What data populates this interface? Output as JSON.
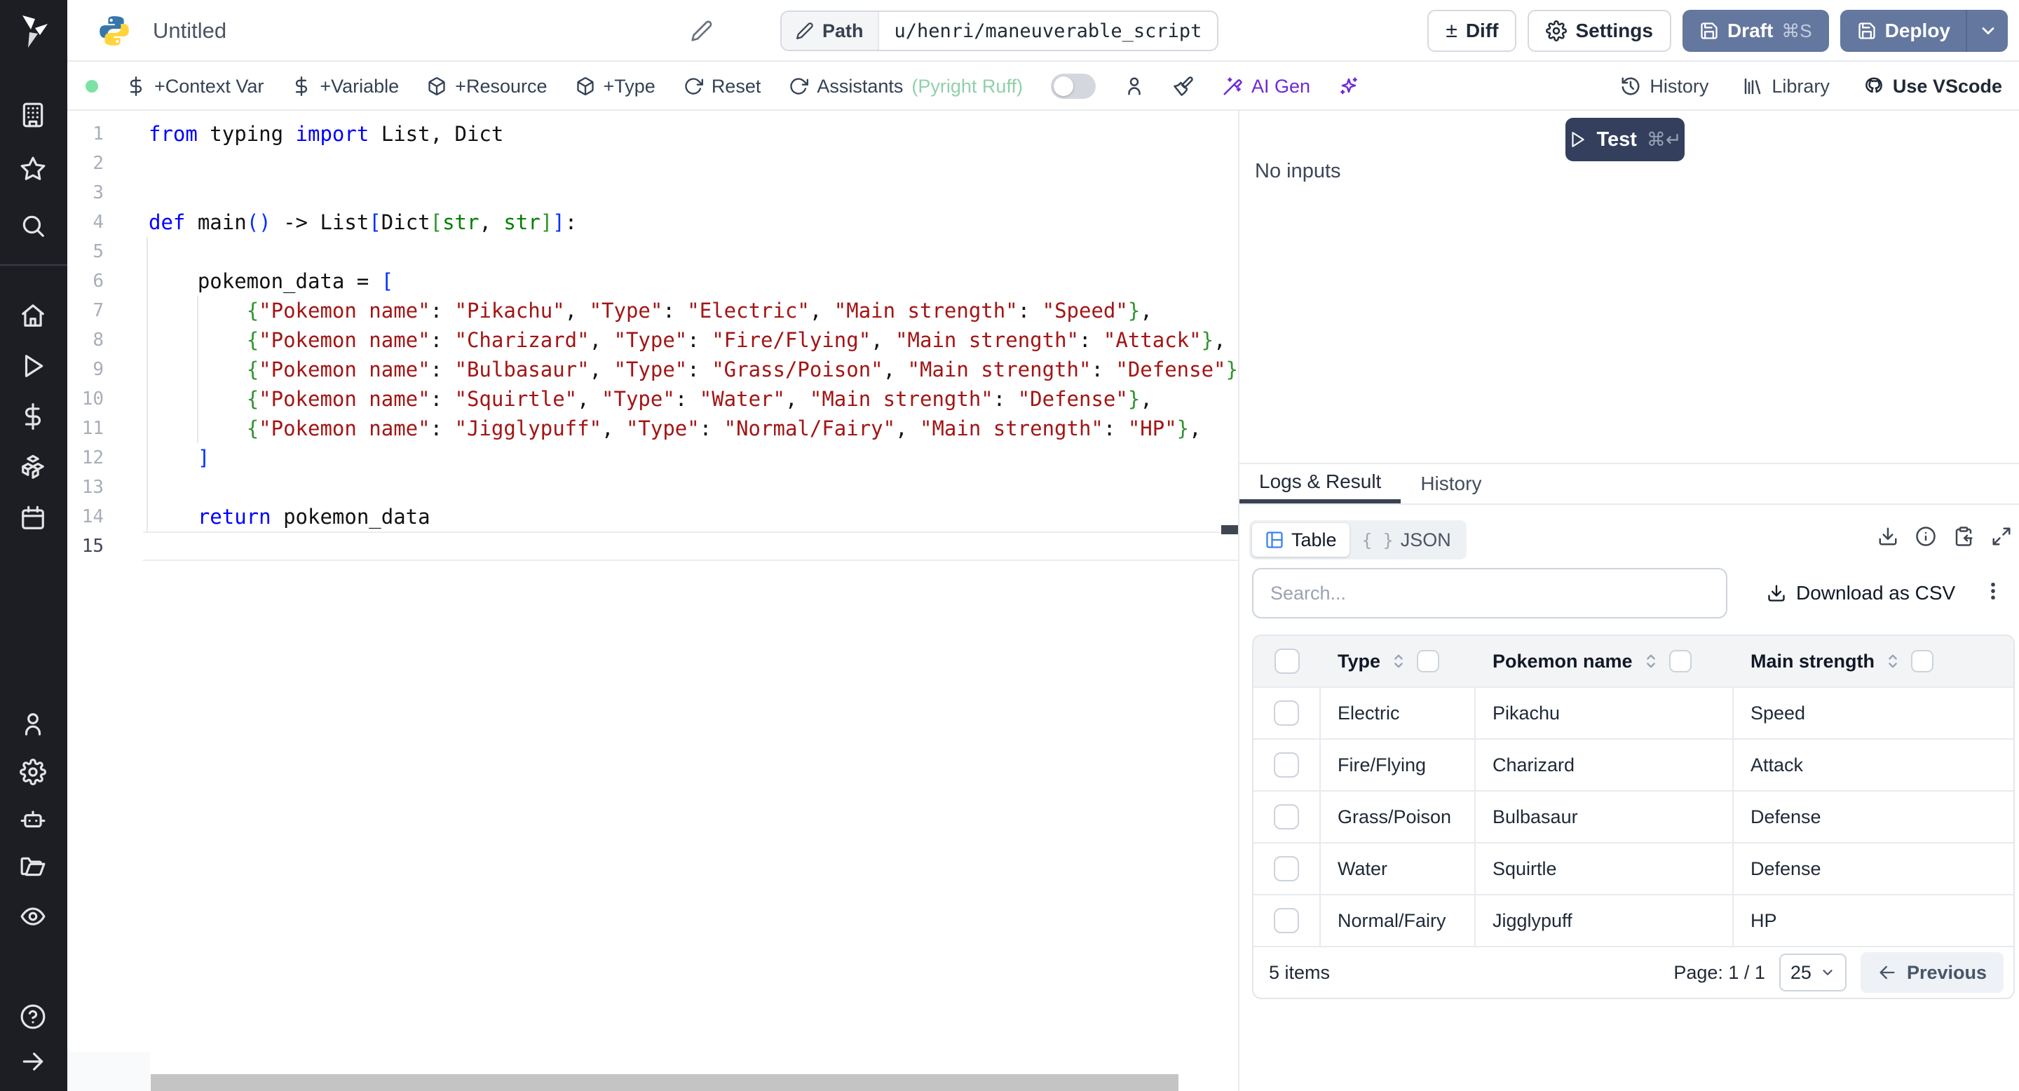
{
  "header": {
    "title": "Untitled",
    "path_label": "Path",
    "path_value": "u/henri/maneuverable_script",
    "diff_label": "Diff",
    "settings_label": "Settings",
    "draft_label": "Draft",
    "draft_shortcut": "⌘S",
    "deploy_label": "Deploy"
  },
  "toolbar": {
    "context_var": "+Context Var",
    "variable": "+Variable",
    "resource": "+Resource",
    "type": "+Type",
    "reset": "Reset",
    "assistants": "Assistants",
    "assistants_status": "(Pyright Ruff)",
    "ai_gen": "AI Gen",
    "history": "History",
    "library": "Library",
    "use_vscode": "Use VScode"
  },
  "run_panel": {
    "test_label": "Test",
    "test_shortcut": "⌘↵",
    "no_inputs": "No inputs"
  },
  "result_panel": {
    "tabs": [
      "Logs & Result",
      "History"
    ],
    "view_table": "Table",
    "view_json": "JSON",
    "braces": "{ }",
    "search_placeholder": "Search...",
    "download_csv": "Download as CSV",
    "table": {
      "columns": [
        "Type",
        "Pokemon name",
        "Main strength"
      ],
      "rows": [
        [
          "Electric",
          "Pikachu",
          "Speed"
        ],
        [
          "Fire/Flying",
          "Charizard",
          "Attack"
        ],
        [
          "Grass/Poison",
          "Bulbasaur",
          "Defense"
        ],
        [
          "Water",
          "Squirtle",
          "Defense"
        ],
        [
          "Normal/Fairy",
          "Jigglypuff",
          "HP"
        ]
      ]
    },
    "footer": {
      "items": "5 items",
      "page": "Page: 1 / 1",
      "page_size": "25",
      "previous": "Previous"
    }
  },
  "editor": {
    "lines": [
      {
        "n": 1,
        "seg": [
          [
            "k",
            "from"
          ],
          [
            "d",
            " typing "
          ],
          [
            "k",
            "import"
          ],
          [
            "d",
            " List, Dict"
          ]
        ]
      },
      {
        "n": 2,
        "seg": []
      },
      {
        "n": 3,
        "seg": []
      },
      {
        "n": 4,
        "seg": [
          [
            "k",
            "def"
          ],
          [
            "d",
            " main"
          ],
          [
            "bb",
            "()"
          ],
          [
            "d",
            " -> List"
          ],
          [
            "bb",
            "["
          ],
          [
            "d",
            "Dict"
          ],
          [
            "gb",
            "["
          ],
          [
            "ty",
            "str"
          ],
          [
            "d",
            ", "
          ],
          [
            "ty",
            "str"
          ],
          [
            "gb",
            "]"
          ],
          [
            "bb",
            "]"
          ],
          [
            "d",
            ":"
          ]
        ]
      },
      {
        "n": 5,
        "seg": []
      },
      {
        "n": 6,
        "seg": [
          [
            "d",
            "    pokemon_data = "
          ],
          [
            "bb",
            "["
          ]
        ]
      },
      {
        "n": 7,
        "seg": [
          [
            "d",
            "        "
          ],
          [
            "gb",
            "{"
          ],
          [
            "s",
            "\"Pokemon name\""
          ],
          [
            "d",
            ": "
          ],
          [
            "s",
            "\"Pikachu\""
          ],
          [
            "d",
            ", "
          ],
          [
            "s",
            "\"Type\""
          ],
          [
            "d",
            ": "
          ],
          [
            "s",
            "\"Electric\""
          ],
          [
            "d",
            ", "
          ],
          [
            "s",
            "\"Main strength\""
          ],
          [
            "d",
            ": "
          ],
          [
            "s",
            "\"Speed\""
          ],
          [
            "gb",
            "}"
          ],
          [
            "d",
            ","
          ]
        ]
      },
      {
        "n": 8,
        "seg": [
          [
            "d",
            "        "
          ],
          [
            "gb",
            "{"
          ],
          [
            "s",
            "\"Pokemon name\""
          ],
          [
            "d",
            ": "
          ],
          [
            "s",
            "\"Charizard\""
          ],
          [
            "d",
            ", "
          ],
          [
            "s",
            "\"Type\""
          ],
          [
            "d",
            ": "
          ],
          [
            "s",
            "\"Fire/Flying\""
          ],
          [
            "d",
            ", "
          ],
          [
            "s",
            "\"Main strength\""
          ],
          [
            "d",
            ": "
          ],
          [
            "s",
            "\"Attack\""
          ],
          [
            "gb",
            "}"
          ],
          [
            "d",
            ","
          ]
        ]
      },
      {
        "n": 9,
        "seg": [
          [
            "d",
            "        "
          ],
          [
            "gb",
            "{"
          ],
          [
            "s",
            "\"Pokemon name\""
          ],
          [
            "d",
            ": "
          ],
          [
            "s",
            "\"Bulbasaur\""
          ],
          [
            "d",
            ", "
          ],
          [
            "s",
            "\"Type\""
          ],
          [
            "d",
            ": "
          ],
          [
            "s",
            "\"Grass/Poison\""
          ],
          [
            "d",
            ", "
          ],
          [
            "s",
            "\"Main strength\""
          ],
          [
            "d",
            ": "
          ],
          [
            "s",
            "\"Defense\""
          ],
          [
            "gb",
            "}"
          ],
          [
            "d",
            ","
          ]
        ]
      },
      {
        "n": 10,
        "seg": [
          [
            "d",
            "        "
          ],
          [
            "gb",
            "{"
          ],
          [
            "s",
            "\"Pokemon name\""
          ],
          [
            "d",
            ": "
          ],
          [
            "s",
            "\"Squirtle\""
          ],
          [
            "d",
            ", "
          ],
          [
            "s",
            "\"Type\""
          ],
          [
            "d",
            ": "
          ],
          [
            "s",
            "\"Water\""
          ],
          [
            "d",
            ", "
          ],
          [
            "s",
            "\"Main strength\""
          ],
          [
            "d",
            ": "
          ],
          [
            "s",
            "\"Defense\""
          ],
          [
            "gb",
            "}"
          ],
          [
            "d",
            ","
          ]
        ]
      },
      {
        "n": 11,
        "seg": [
          [
            "d",
            "        "
          ],
          [
            "gb",
            "{"
          ],
          [
            "s",
            "\"Pokemon name\""
          ],
          [
            "d",
            ": "
          ],
          [
            "s",
            "\"Jigglypuff\""
          ],
          [
            "d",
            ", "
          ],
          [
            "s",
            "\"Type\""
          ],
          [
            "d",
            ": "
          ],
          [
            "s",
            "\"Normal/Fairy\""
          ],
          [
            "d",
            ", "
          ],
          [
            "s",
            "\"Main strength\""
          ],
          [
            "d",
            ": "
          ],
          [
            "s",
            "\"HP\""
          ],
          [
            "gb",
            "}"
          ],
          [
            "d",
            ","
          ]
        ]
      },
      {
        "n": 12,
        "seg": [
          [
            "d",
            "    "
          ],
          [
            "bb",
            "]"
          ]
        ]
      },
      {
        "n": 13,
        "seg": []
      },
      {
        "n": 14,
        "seg": [
          [
            "d",
            "    "
          ],
          [
            "k",
            "return"
          ],
          [
            "d",
            " pokemon_data"
          ]
        ]
      },
      {
        "n": 15,
        "seg": [],
        "current": true
      }
    ]
  },
  "colors": {
    "accent_button": "#64779e",
    "test_button": "#333f5c",
    "status_dot": "#7ce2a3",
    "ai_purple": "#6d28d9",
    "keyword": "#0000ff",
    "string": "#a31515",
    "table_icon_blue": "#3b82f6",
    "pyright_green": "#8fd0ab"
  }
}
